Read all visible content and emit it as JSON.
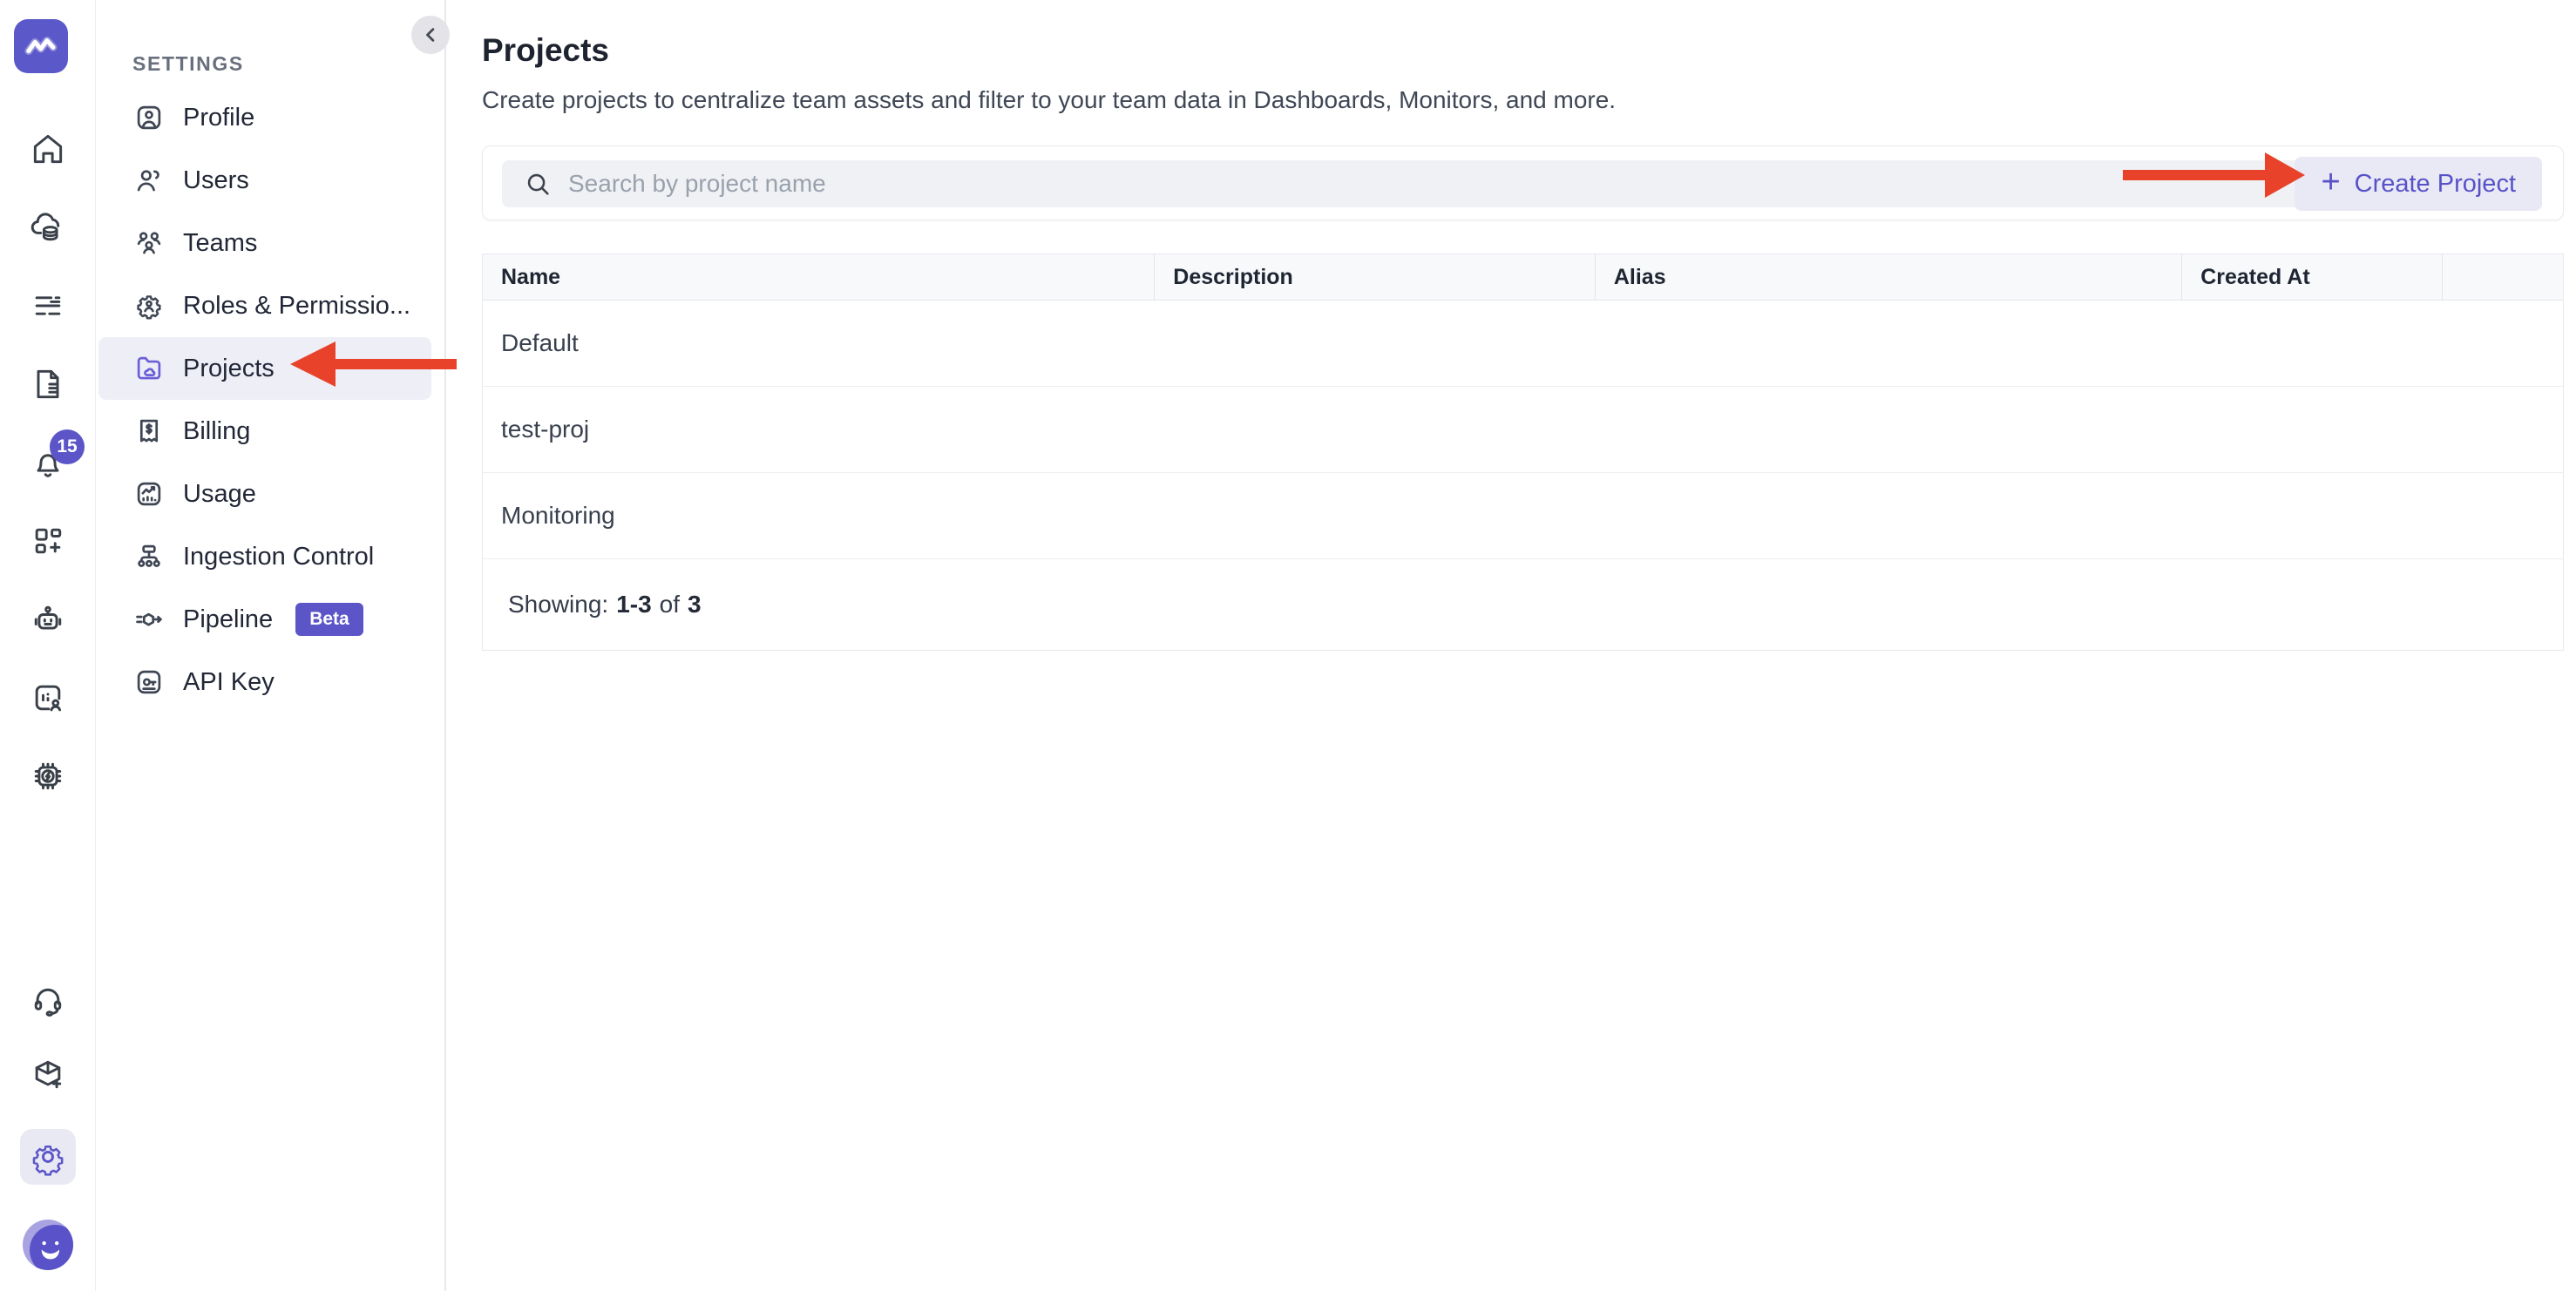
{
  "colors": {
    "accent": "#5B55C8",
    "accent_light_bg": "#E9E9F6",
    "active_item_bg": "#EEEEF7",
    "annotation_arrow": "#E8432A"
  },
  "icon_rail": {
    "notification_count": "15",
    "items": [
      {
        "icon": "home-icon"
      },
      {
        "icon": "infrastructure-icon"
      },
      {
        "icon": "filter-lines-icon"
      },
      {
        "icon": "logs-document-icon"
      },
      {
        "icon": "alerts-bell-icon",
        "badge": "15"
      },
      {
        "icon": "dashboard-add-icon"
      },
      {
        "icon": "ai-bot-icon"
      },
      {
        "icon": "rum-monitor-icon"
      },
      {
        "icon": "processor-chip-icon"
      }
    ],
    "bottom_items": [
      {
        "icon": "support-headset-icon"
      },
      {
        "icon": "install-box-icon"
      },
      {
        "icon": "settings-gear-icon",
        "active": true
      },
      {
        "icon": "user-avatar"
      }
    ]
  },
  "settings_nav": {
    "heading": "SETTINGS",
    "items": [
      {
        "label": "Profile"
      },
      {
        "label": "Users"
      },
      {
        "label": "Teams"
      },
      {
        "label": "Roles & Permissio..."
      },
      {
        "label": "Projects",
        "active": true
      },
      {
        "label": "Billing"
      },
      {
        "label": "Usage"
      },
      {
        "label": "Ingestion Control"
      },
      {
        "label": "Pipeline",
        "badge": "Beta"
      },
      {
        "label": "API Key"
      }
    ]
  },
  "main": {
    "title": "Projects",
    "description": "Create projects to centralize team assets and filter to your team data in Dashboards, Monitors, and more.",
    "search": {
      "placeholder": "Search by project name"
    },
    "create_button": {
      "plus": "+",
      "label": "Create Project"
    }
  },
  "table": {
    "columns": [
      "Name",
      "Description",
      "Alias",
      "Created At",
      ""
    ],
    "rows": [
      {
        "name": "Default",
        "description": "",
        "alias": "",
        "created_at": ""
      },
      {
        "name": "test-proj",
        "description": "",
        "alias": "",
        "created_at": ""
      },
      {
        "name": "Monitoring",
        "description": "",
        "alias": "",
        "created_at": ""
      }
    ],
    "footer": {
      "label": "Showing:",
      "range": "1-3",
      "of": "of",
      "total": "3"
    }
  }
}
